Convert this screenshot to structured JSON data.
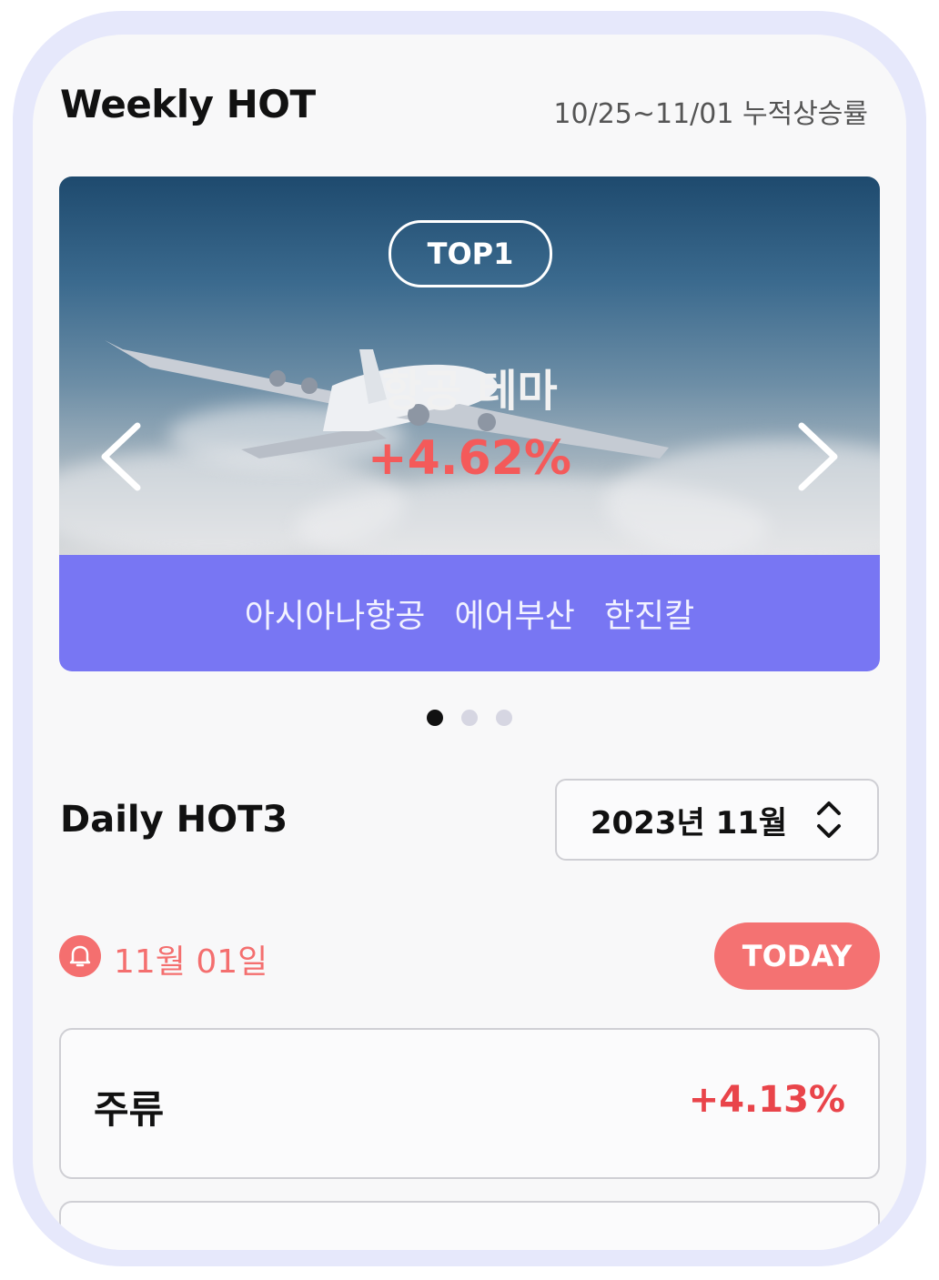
{
  "weekly": {
    "title": "Weekly HOT",
    "range": "10/25~11/01 누적상승률"
  },
  "banner": {
    "rank_badge": "TOP1",
    "theme_name": "항공 테마",
    "rate": "+4.62%",
    "stocks": [
      "아시아나항공",
      "에어부산",
      "한진칼"
    ],
    "accent_color": "#7876f3",
    "rate_color": "#f45a5a"
  },
  "carousel": {
    "total_pages": 3,
    "active_index": 0
  },
  "daily": {
    "title": "Daily HOT3",
    "month_selector": "2023년 11월",
    "date_label": "11월 01일",
    "today_label": "TODAY",
    "items": [
      {
        "name": "주류",
        "rate": "+4.13%"
      }
    ]
  },
  "icons": {
    "prev": "chevron-left-icon",
    "next": "chevron-right-icon",
    "select": "up-down-chevron-icon",
    "bell": "bell-icon"
  }
}
